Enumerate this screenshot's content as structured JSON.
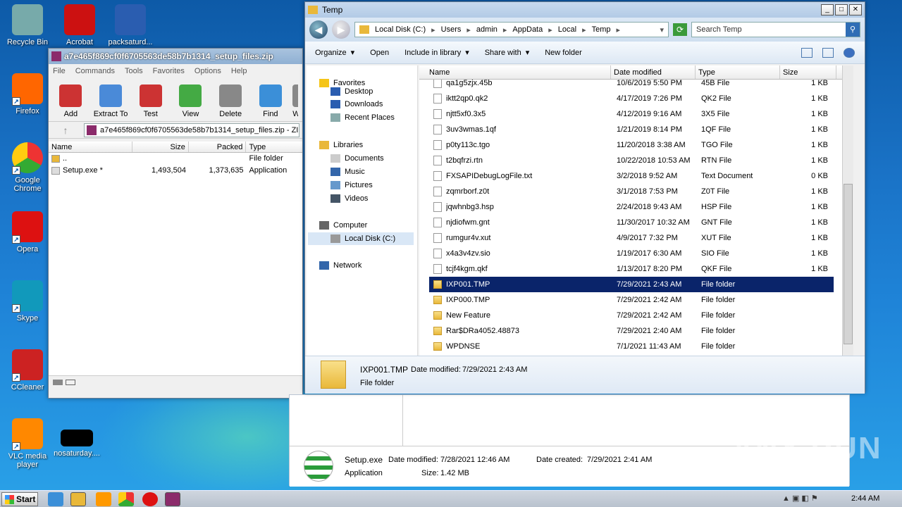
{
  "desktop": {
    "icons": [
      {
        "label": "Recycle Bin",
        "icon": "recycle-bin-icon"
      },
      {
        "label": "Acrobat",
        "icon": "acrobat-icon"
      },
      {
        "label": "packsaturd...",
        "icon": "word-doc-icon"
      },
      {
        "label": "Firefox",
        "icon": "firefox-icon"
      },
      {
        "label": "Google Chrome",
        "icon": "chrome-icon"
      },
      {
        "label": "Opera",
        "icon": "opera-icon"
      },
      {
        "label": "Skype",
        "icon": "skype-icon"
      },
      {
        "label": "CCleaner",
        "icon": "ccleaner-icon"
      },
      {
        "label": "VLC media player",
        "icon": "vlc-icon"
      },
      {
        "label": "nosaturday....",
        "icon": "black-file-icon"
      }
    ]
  },
  "winrar": {
    "title": "a7e465f869cf0f6705563de58b7b1314_setup_files.zip",
    "menu": [
      "File",
      "Commands",
      "Tools",
      "Favorites",
      "Options",
      "Help"
    ],
    "toolbar": [
      "Add",
      "Extract To",
      "Test",
      "View",
      "Delete",
      "Find",
      "W"
    ],
    "path": "a7e465f869cf0f6705563de58b7b1314_setup_files.zip - ZIP",
    "columns": [
      "Name",
      "Size",
      "Packed",
      "Type"
    ],
    "rows": [
      {
        "name": "..",
        "size": "",
        "packed": "",
        "type": "File folder"
      },
      {
        "name": "Setup.exe *",
        "size": "1,493,504",
        "packed": "1,373,635",
        "type": "Application"
      }
    ],
    "details": {
      "name": "Setup.exe",
      "modified_label": "Date modified:",
      "modified": "7/28/2021 12:46 AM",
      "created_label": "Date created:",
      "created": "7/29/2021 2:41 AM",
      "type": "Application",
      "size_label": "Size:",
      "size": "1.42 MB"
    }
  },
  "explorer": {
    "title": "Temp",
    "breadcrumb": [
      "Local Disk (C:)",
      "Users",
      "admin",
      "AppData",
      "Local",
      "Temp"
    ],
    "search_placeholder": "Search Temp",
    "commands": [
      "Organize",
      "Open",
      "Include in library",
      "Share with",
      "New folder"
    ],
    "nav": {
      "favorites": "Favorites",
      "desktop": "Desktop",
      "downloads": "Downloads",
      "recent": "Recent Places",
      "libraries": "Libraries",
      "documents": "Documents",
      "music": "Music",
      "pictures": "Pictures",
      "videos": "Videos",
      "computer": "Computer",
      "localdisk": "Local Disk (C:)",
      "network": "Network"
    },
    "columns": [
      "Name",
      "Date modified",
      "Type",
      "Size"
    ],
    "files": [
      {
        "name": "qa1g5zjx.45b",
        "date": "10/6/2019 5:50 PM",
        "type": "45B File",
        "size": "1 KB",
        "folder": false
      },
      {
        "name": "iktt2qp0.qk2",
        "date": "4/17/2019 7:26 PM",
        "type": "QK2 File",
        "size": "1 KB",
        "folder": false
      },
      {
        "name": "njtt5xf0.3x5",
        "date": "4/12/2019 9:16 AM",
        "type": "3X5 File",
        "size": "1 KB",
        "folder": false
      },
      {
        "name": "3uv3wmas.1qf",
        "date": "1/21/2019 8:14 PM",
        "type": "1QF File",
        "size": "1 KB",
        "folder": false
      },
      {
        "name": "p0ty113c.tgo",
        "date": "11/20/2018 3:38 AM",
        "type": "TGO File",
        "size": "1 KB",
        "folder": false
      },
      {
        "name": "t2bqfrzi.rtn",
        "date": "10/22/2018 10:53 AM",
        "type": "RTN File",
        "size": "1 KB",
        "folder": false
      },
      {
        "name": "FXSAPIDebugLogFile.txt",
        "date": "3/2/2018 9:52 AM",
        "type": "Text Document",
        "size": "0 KB",
        "folder": false
      },
      {
        "name": "zqmrborf.z0t",
        "date": "3/1/2018 7:53 PM",
        "type": "Z0T File",
        "size": "1 KB",
        "folder": false
      },
      {
        "name": "jqwhnbg3.hsp",
        "date": "2/24/2018 9:43 AM",
        "type": "HSP File",
        "size": "1 KB",
        "folder": false
      },
      {
        "name": "njdiofwm.gnt",
        "date": "11/30/2017 10:32 AM",
        "type": "GNT File",
        "size": "1 KB",
        "folder": false
      },
      {
        "name": "rumgur4v.xut",
        "date": "4/9/2017 7:32 PM",
        "type": "XUT File",
        "size": "1 KB",
        "folder": false
      },
      {
        "name": "x4a3v4zv.sio",
        "date": "1/19/2017 6:30 AM",
        "type": "SIO File",
        "size": "1 KB",
        "folder": false
      },
      {
        "name": "tcjf4kgm.qkf",
        "date": "1/13/2017 8:20 PM",
        "type": "QKF File",
        "size": "1 KB",
        "folder": false
      },
      {
        "name": "IXP001.TMP",
        "date": "7/29/2021 2:43 AM",
        "type": "File folder",
        "size": "",
        "folder": true,
        "selected": true
      },
      {
        "name": "IXP000.TMP",
        "date": "7/29/2021 2:42 AM",
        "type": "File folder",
        "size": "",
        "folder": true
      },
      {
        "name": "New Feature",
        "date": "7/29/2021 2:42 AM",
        "type": "File folder",
        "size": "",
        "folder": true
      },
      {
        "name": "Rar$DRa4052.48873",
        "date": "7/29/2021 2:40 AM",
        "type": "File folder",
        "size": "",
        "folder": true
      },
      {
        "name": "WPDNSE",
        "date": "7/1/2021 11:43 AM",
        "type": "File folder",
        "size": "",
        "folder": true
      }
    ],
    "details": {
      "name": "IXP001.TMP",
      "modified_label": "Date modified:",
      "modified": "7/29/2021 2:43 AM",
      "type": "File folder"
    }
  },
  "taskbar": {
    "start": "Start",
    "clock": "2:44 AM"
  },
  "watermark": "ANY RUN"
}
